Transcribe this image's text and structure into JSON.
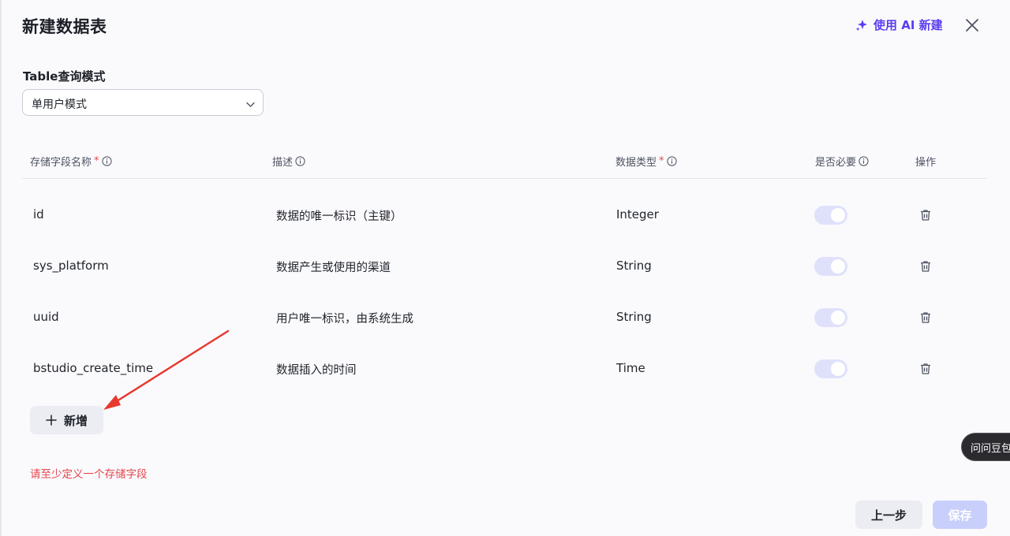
{
  "dialog": {
    "title": "新建数据表",
    "ai_create_label": "使用 AI 新建"
  },
  "mode": {
    "label": "Table查询模式",
    "selected": "单用户模式"
  },
  "table": {
    "headers": {
      "name": "存储字段名称",
      "desc": "描述",
      "type": "数据类型",
      "required": "是否必要",
      "actions": "操作",
      "required_mark": "*"
    },
    "rows": [
      {
        "name": "id",
        "desc": "数据的唯一标识（主键）",
        "type": "Integer",
        "required": true
      },
      {
        "name": "sys_platform",
        "desc": "数据产生或使用的渠道",
        "type": "String",
        "required": true
      },
      {
        "name": "uuid",
        "desc": "用户唯一标识，由系统生成",
        "type": "String",
        "required": true
      },
      {
        "name": "bstudio_create_time",
        "desc": "数据插入的时间",
        "type": "Time",
        "required": true
      }
    ]
  },
  "add_button_label": "新增",
  "error_message": "请至少定义一个存储字段",
  "assistant_label": "问问豆包",
  "footer": {
    "prev_label": "上一步",
    "save_label": "保存"
  },
  "colors": {
    "accent": "#5b3cf0",
    "error": "#e5484d",
    "toggle_disabled": "#dfe1fb",
    "annotation_arrow": "#e8392f"
  }
}
